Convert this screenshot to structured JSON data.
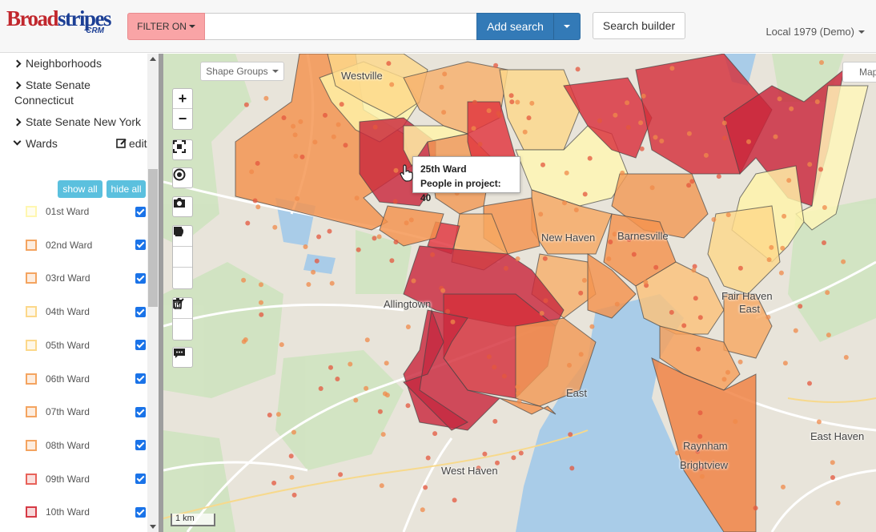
{
  "header": {
    "logo_text_red": "Broad",
    "logo_text_blue": "stripes",
    "logo_sub": "CRM",
    "filter_label": "FILTER ON",
    "search_value": "",
    "search_placeholder": "",
    "add_search_label": "Add search",
    "search_builder_label": "Search builder",
    "account_label": "Local 1979 (Demo)"
  },
  "sidebar": {
    "categories": [
      {
        "label": "Neighborhoods",
        "expanded": false
      },
      {
        "label": "State Senate Connecticut",
        "expanded": false
      },
      {
        "label": "State Senate New York",
        "expanded": false
      },
      {
        "label": "Wards",
        "expanded": true
      }
    ],
    "edit_label": "edit",
    "show_all_label": "show all",
    "hide_all_label": "hide all",
    "wards": [
      {
        "label": "01st Ward",
        "color": "#fff7b0",
        "checked": true
      },
      {
        "label": "02nd Ward",
        "color": "#f4a460",
        "checked": true
      },
      {
        "label": "03rd Ward",
        "color": "#f4a460",
        "checked": true
      },
      {
        "label": "04th Ward",
        "color": "#fcd88a",
        "checked": true
      },
      {
        "label": "05th Ward",
        "color": "#fcd88a",
        "checked": true
      },
      {
        "label": "06th Ward",
        "color": "#f4a460",
        "checked": true
      },
      {
        "label": "07th Ward",
        "color": "#f4a460",
        "checked": true
      },
      {
        "label": "08th Ward",
        "color": "#f4a460",
        "checked": true
      },
      {
        "label": "09th Ward",
        "color": "#e8625a",
        "checked": true
      },
      {
        "label": "10th Ward",
        "color": "#d63a45",
        "checked": true
      }
    ]
  },
  "map": {
    "shape_groups_label": "Shape Groups",
    "map_type_label": "Map",
    "tooltip": {
      "title": "25th Ward",
      "line": "People in project: 40"
    },
    "scale_label": "1 km",
    "places": [
      "Westville",
      "New Haven",
      "Barnesville",
      "Allingtown",
      "Fair Haven",
      "East",
      "West Haven",
      "East Haven",
      "Raynham",
      "Brightview",
      "East"
    ]
  }
}
